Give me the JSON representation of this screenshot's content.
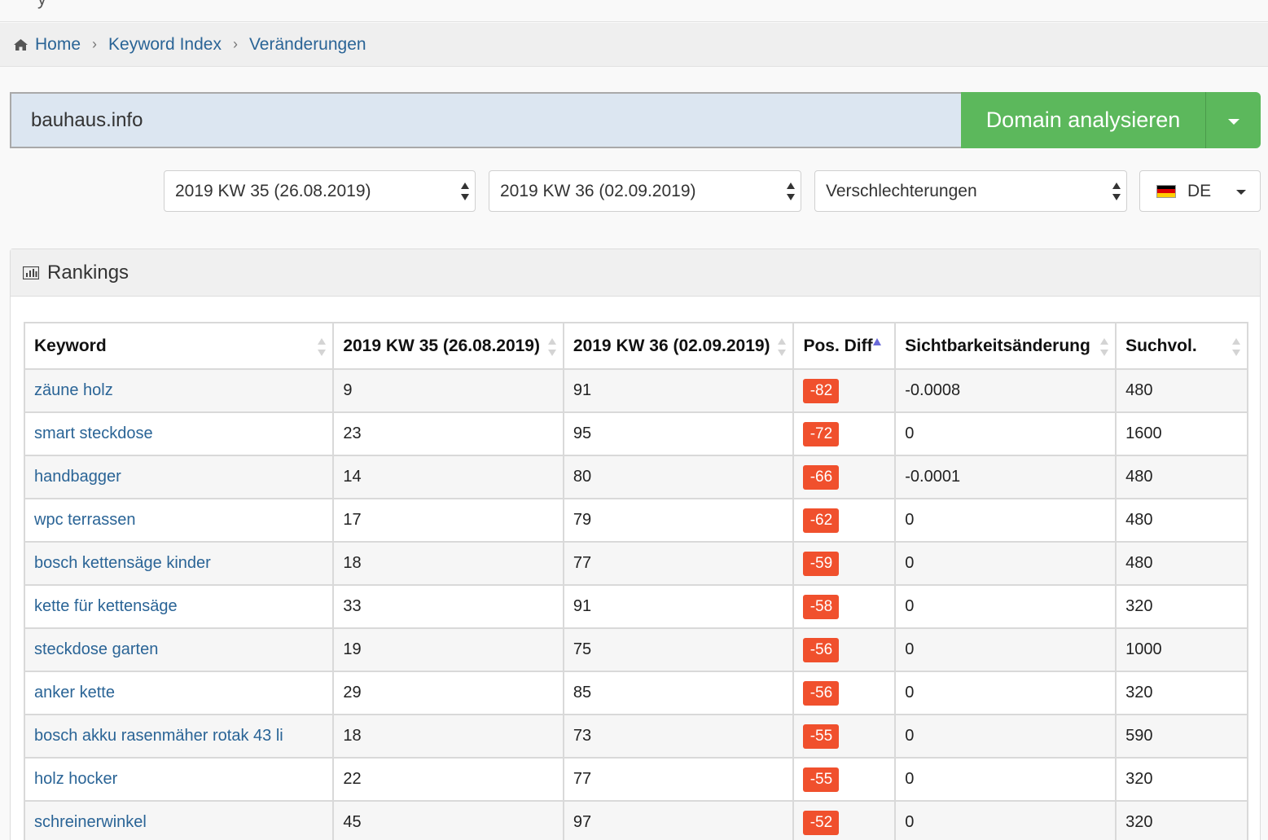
{
  "topbar": {
    "glyph": "y"
  },
  "breadcrumb": {
    "items": [
      "Home",
      "Keyword Index",
      "Veränderungen"
    ],
    "separator": "›"
  },
  "search": {
    "domain_value": "bauhaus.info",
    "analyze_label": "Domain analysieren"
  },
  "filters": {
    "week_from": "2019 KW 35 (26.08.2019)",
    "week_to": "2019 KW 36 (02.09.2019)",
    "change_type": "Verschlechterungen",
    "country": "DE",
    "flag_colors": [
      "#000000",
      "#dd0000",
      "#ffce00"
    ]
  },
  "panel": {
    "title": "Rankings",
    "icon": "bar-chart-icon"
  },
  "table": {
    "headers": [
      "Keyword",
      "2019 KW 35 (26.08.2019)",
      "2019 KW 36 (02.09.2019)",
      "Pos. Diff",
      "Sichtbarkeitsänderung",
      "Suchvol."
    ],
    "rows": [
      {
        "keyword": "zäune holz",
        "pos_from": "9",
        "pos_to": "91",
        "diff": "-82",
        "visibility": "-0.0008",
        "volume": "480"
      },
      {
        "keyword": "smart steckdose",
        "pos_from": "23",
        "pos_to": "95",
        "diff": "-72",
        "visibility": "0",
        "volume": "1600"
      },
      {
        "keyword": "handbagger",
        "pos_from": "14",
        "pos_to": "80",
        "diff": "-66",
        "visibility": "-0.0001",
        "volume": "480"
      },
      {
        "keyword": "wpc terrassen",
        "pos_from": "17",
        "pos_to": "79",
        "diff": "-62",
        "visibility": "0",
        "volume": "480"
      },
      {
        "keyword": "bosch kettensäge kinder",
        "pos_from": "18",
        "pos_to": "77",
        "diff": "-59",
        "visibility": "0",
        "volume": "480"
      },
      {
        "keyword": "kette für kettensäge",
        "pos_from": "33",
        "pos_to": "91",
        "diff": "-58",
        "visibility": "0",
        "volume": "320"
      },
      {
        "keyword": "steckdose garten",
        "pos_from": "19",
        "pos_to": "75",
        "diff": "-56",
        "visibility": "0",
        "volume": "1000"
      },
      {
        "keyword": "anker kette",
        "pos_from": "29",
        "pos_to": "85",
        "diff": "-56",
        "visibility": "0",
        "volume": "320"
      },
      {
        "keyword": "bosch akku rasenmäher rotak 43 li",
        "pos_from": "18",
        "pos_to": "73",
        "diff": "-55",
        "visibility": "0",
        "volume": "590"
      },
      {
        "keyword": "holz hocker",
        "pos_from": "22",
        "pos_to": "77",
        "diff": "-55",
        "visibility": "0",
        "volume": "320"
      },
      {
        "keyword": "schreinerwinkel",
        "pos_from": "45",
        "pos_to": "97",
        "diff": "-52",
        "visibility": "0",
        "volume": "320"
      }
    ]
  },
  "colors": {
    "link": "#2a6496",
    "analyze_button": "#5cb85c",
    "negative_badge": "#f0502d",
    "input_bg": "#dce6f1"
  }
}
